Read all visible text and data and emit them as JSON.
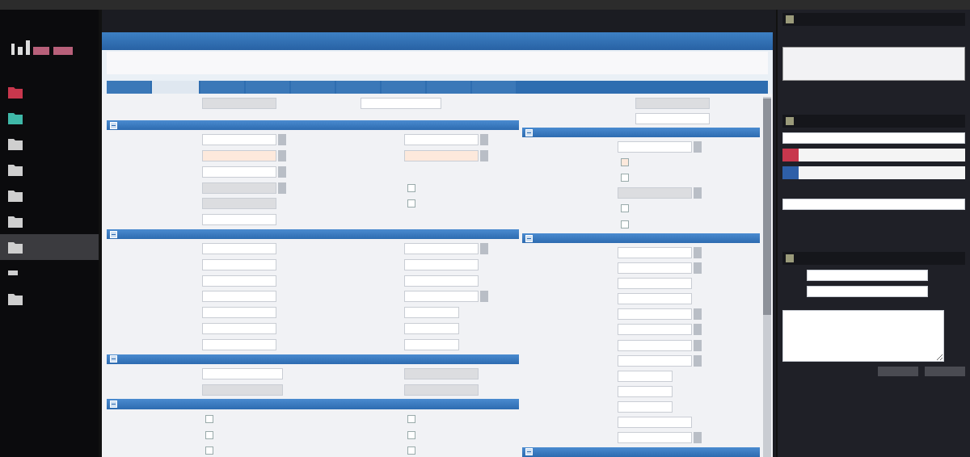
{
  "sidebar": {
    "items": [
      {
        "kind": "item",
        "selected": false,
        "color": "#c8374d"
      },
      {
        "kind": "item",
        "selected": false,
        "color": "#3fb8a8"
      },
      {
        "kind": "item",
        "selected": false,
        "color": "#cfcfcf"
      },
      {
        "kind": "item",
        "selected": false,
        "color": "#cfcfcf"
      },
      {
        "kind": "item",
        "selected": false,
        "color": "#cfcfcf"
      },
      {
        "kind": "item",
        "selected": false,
        "color": "#cfcfcf"
      },
      {
        "kind": "item",
        "selected": true,
        "color": "#cfcfcf"
      },
      {
        "kind": "group",
        "selected": false,
        "color": "#cfcfcf"
      },
      {
        "kind": "item",
        "selected": false,
        "color": "#cfcfcf"
      }
    ]
  },
  "tabs": [
    {
      "selected": false
    },
    {
      "selected": true
    },
    {
      "selected": false
    },
    {
      "selected": false
    },
    {
      "selected": false
    },
    {
      "selected": false
    },
    {
      "selected": false
    },
    {
      "selected": false
    },
    {
      "selected": false
    }
  ],
  "header_fields": [
    {
      "kind": "locked"
    },
    {
      "kind": "wide"
    }
  ],
  "left_sections": [
    {
      "expanded": true,
      "rows": [
        [
          {
            "kind": "select"
          },
          {
            "kind": "select"
          }
        ],
        [
          {
            "kind": "select-required"
          },
          {
            "kind": "select-required"
          }
        ],
        [
          {
            "kind": "select"
          }
        ],
        [
          {
            "kind": "select-locked"
          },
          {
            "kind": "check"
          }
        ],
        [
          {
            "kind": "locked"
          },
          {
            "kind": "check"
          }
        ],
        [
          {
            "kind": "text"
          }
        ]
      ]
    },
    {
      "expanded": true,
      "rows": [
        [
          {
            "kind": "text"
          },
          {
            "kind": "select"
          }
        ],
        [
          {
            "kind": "text"
          },
          {
            "kind": "text"
          }
        ],
        [
          {
            "kind": "text"
          },
          {
            "kind": "text"
          }
        ],
        [
          {
            "kind": "text"
          },
          {
            "kind": "select"
          }
        ],
        [
          {
            "kind": "text"
          },
          {
            "kind": "short"
          }
        ],
        [
          {
            "kind": "text"
          },
          {
            "kind": "short"
          }
        ],
        [
          {
            "kind": "text"
          },
          {
            "kind": "short"
          }
        ]
      ]
    },
    {
      "expanded": true,
      "rows": [
        [
          {
            "kind": "wide"
          },
          {
            "kind": "locked"
          }
        ],
        [
          {
            "kind": "wide-locked"
          },
          {
            "kind": "locked"
          }
        ]
      ]
    },
    {
      "expanded": true,
      "rows": [
        [
          {
            "kind": "check"
          },
          {
            "kind": "check"
          }
        ],
        [
          {
            "kind": "check"
          },
          {
            "kind": "check"
          }
        ],
        [
          {
            "kind": "check"
          },
          {
            "kind": "check"
          }
        ]
      ]
    }
  ],
  "right_top_fields": [
    {
      "kind": "locked"
    },
    {
      "kind": "text"
    }
  ],
  "right_sections": [
    {
      "expanded": true,
      "rows": [
        {
          "kind": "select"
        },
        {
          "kind": "check-required"
        },
        {
          "kind": "check"
        },
        {
          "kind": "select-locked"
        },
        {
          "kind": "check"
        },
        {
          "kind": "check"
        }
      ]
    },
    {
      "expanded": true,
      "rows": [
        {
          "kind": "select"
        },
        {
          "kind": "select"
        },
        {
          "kind": "text"
        },
        {
          "kind": "text"
        },
        {
          "kind": "select"
        },
        {
          "kind": "select"
        },
        {
          "kind": "select"
        },
        {
          "kind": "select"
        },
        {
          "kind": "short"
        },
        {
          "kind": "short"
        },
        {
          "kind": "short"
        },
        {
          "kind": "text"
        },
        {
          "kind": "select"
        }
      ]
    },
    {
      "expanded": true
    }
  ],
  "panel_list": [
    {
      "color": "#c8374d"
    },
    {
      "color": "#2e5fa8"
    }
  ]
}
